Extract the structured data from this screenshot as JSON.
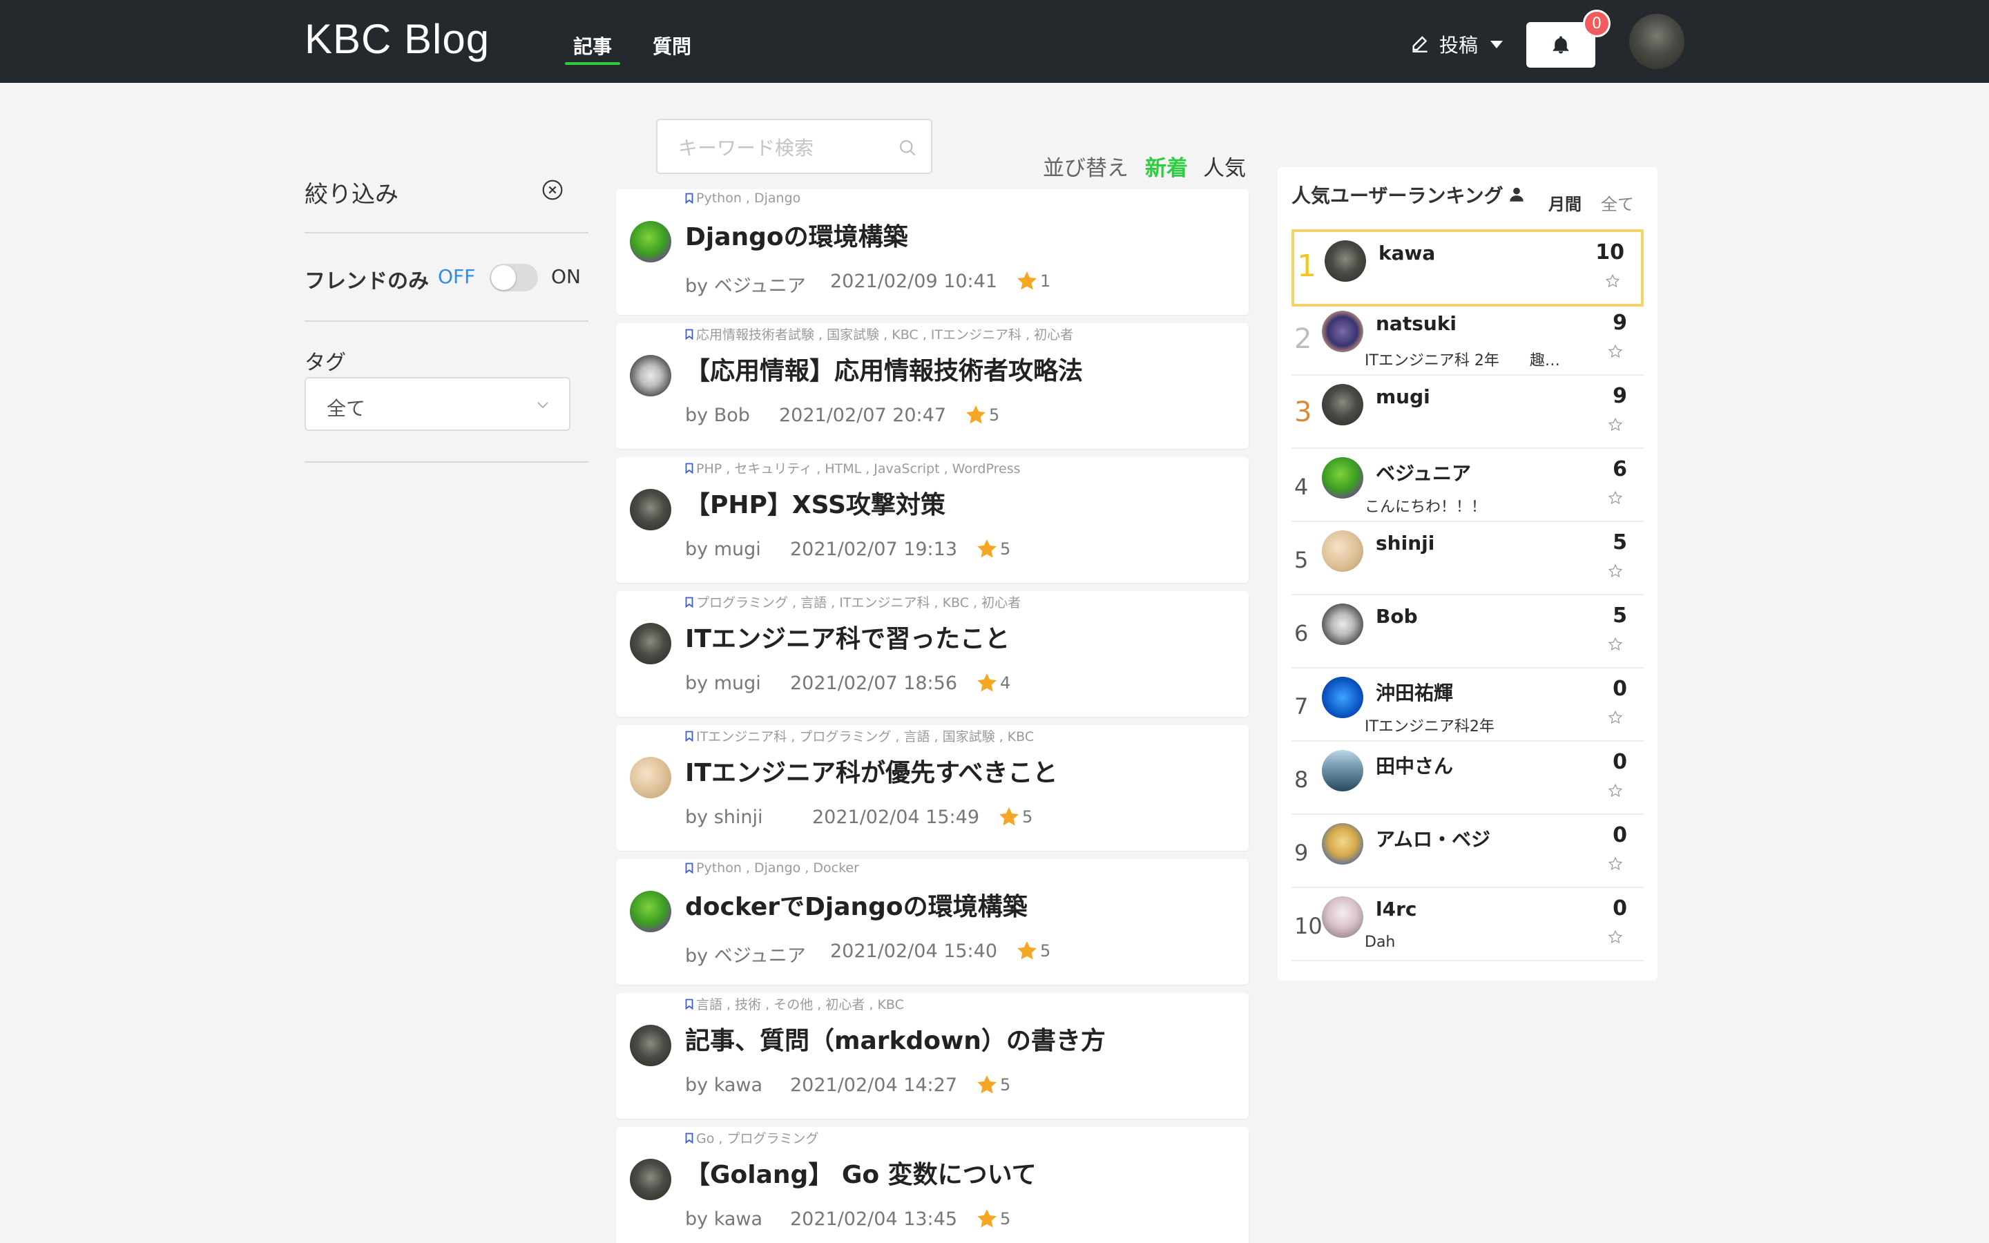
{
  "header": {
    "brand": "KBC Blog",
    "tabs": [
      {
        "label": "記事",
        "active": true
      },
      {
        "label": "質問",
        "active": false
      }
    ],
    "post_label": "投稿",
    "notification_count": "0"
  },
  "filter": {
    "title": "絞り込み",
    "friend_only_label": "フレンドのみ",
    "off_label": "OFF",
    "on_label": "ON",
    "tag_label": "タグ",
    "tag_selected": "全て"
  },
  "search": {
    "placeholder": "キーワード検索"
  },
  "sort": {
    "label": "並び替え",
    "newest": "新着",
    "popular": "人気"
  },
  "articles": [
    {
      "tags": "Python , Django",
      "title": "Djangoの環境構築",
      "author": "by ベジュニア",
      "date": "2021/02/09 10:41",
      "stars": "1",
      "avatar": "green"
    },
    {
      "tags": "応用情報技術者試験 , 国家試験 , KBC , ITエンジニア科 , 初心者",
      "title": "【応用情報】応用情報技術者攻略法",
      "author": "by Bob",
      "date": "2021/02/07 20:47",
      "stars": "5",
      "avatar": "bob"
    },
    {
      "tags": "PHP , セキュリティ , HTML , JavaScript , WordPress",
      "title": "【PHP】XSS攻撃対策",
      "author": "by mugi",
      "date": "2021/02/07 19:13",
      "stars": "5",
      "avatar": "dark"
    },
    {
      "tags": "プログラミング , 言語 , ITエンジニア科 , KBC , 初心者",
      "title": "ITエンジニア科で習ったこと",
      "author": "by mugi",
      "date": "2021/02/07 18:56",
      "stars": "4",
      "avatar": "dark"
    },
    {
      "tags": "ITエンジニア科 , プログラミング , 言語 , 国家試験 , KBC",
      "title": "ITエンジニア科が優先すべきこと",
      "author": "by shinji",
      "date": "2021/02/04 15:49",
      "stars": "5",
      "avatar": "shinji"
    },
    {
      "tags": "Python , Django , Docker",
      "title": "dockerでDjangoの環境構築",
      "author": "by ベジュニア",
      "date": "2021/02/04 15:40",
      "stars": "5",
      "avatar": "green"
    },
    {
      "tags": "言語 , 技術 , その他 , 初心者 , KBC",
      "title": "記事、質問（markdown）の書き方",
      "author": "by kawa",
      "date": "2021/02/04 14:27",
      "stars": "5",
      "avatar": "dark"
    },
    {
      "tags": "Go , プログラミング",
      "title": "【Golang】 Go 変数について",
      "author": "by kawa",
      "date": "2021/02/04 13:45",
      "stars": "5",
      "avatar": "dark"
    }
  ],
  "ranking": {
    "title": "人気ユーザーランキング",
    "monthly": "月間",
    "all": "全て",
    "rows": [
      {
        "rank": "1",
        "name": "kawa",
        "bio": "",
        "count": "10",
        "avatar": "dark"
      },
      {
        "rank": "2",
        "name": "natsuki",
        "bio": "ITエンジニア科 2年　　趣…",
        "count": "9",
        "avatar": "natsuki"
      },
      {
        "rank": "3",
        "name": "mugi",
        "bio": "",
        "count": "9",
        "avatar": "dark"
      },
      {
        "rank": "4",
        "name": "ベジュニア",
        "bio": "こんにちわ！！！",
        "count": "6",
        "avatar": "green"
      },
      {
        "rank": "5",
        "name": "shinji",
        "bio": "",
        "count": "5",
        "avatar": "shinji"
      },
      {
        "rank": "6",
        "name": "Bob",
        "bio": "",
        "count": "5",
        "avatar": "bob"
      },
      {
        "rank": "7",
        "name": "沖田祐輝",
        "bio": "ITエンジニア科2年",
        "count": "0",
        "avatar": "blue"
      },
      {
        "rank": "8",
        "name": "田中さん",
        "bio": "",
        "count": "0",
        "avatar": "sea"
      },
      {
        "rank": "9",
        "name": "アムロ・ベジ",
        "bio": "",
        "count": "0",
        "avatar": "amuro"
      },
      {
        "rank": "10",
        "name": "l4rc",
        "bio": "Dah",
        "count": "0",
        "avatar": "l4rc"
      }
    ]
  },
  "colors": {
    "navbar": "#24292e",
    "accent_green": "#2ecc40",
    "star": "#f5a623",
    "badge": "#f05b5b",
    "gold": "#f2c81e",
    "bronze": "#d8893a",
    "link_blue": "#2d8ce6"
  },
  "icons": {
    "post": "pencil-icon",
    "notification": "bell-icon",
    "clear": "close-circle-icon",
    "search": "search-icon",
    "tag": "bookmark-icon",
    "star": "star-icon",
    "user": "user-icon",
    "dropdown": "chevron-down-icon"
  }
}
